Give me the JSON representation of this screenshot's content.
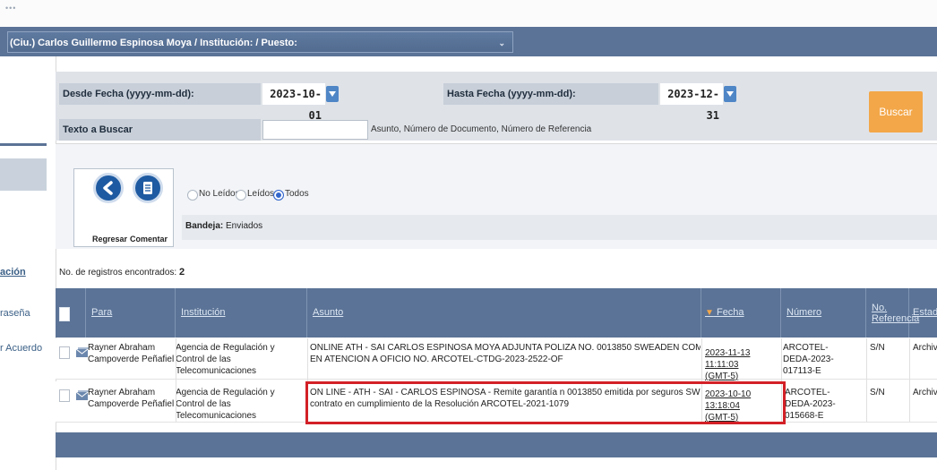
{
  "user_bar": {
    "title": "(Ciu.) Carlos Guillermo Espinosa Moya / Institución: / Puesto:"
  },
  "left_nav": {
    "items": [
      "ación",
      "raseña",
      "r Acuerdo"
    ]
  },
  "filters": {
    "desde_label": "Desde Fecha (yyyy-mm-dd):",
    "desde_value": "2023-10-01",
    "hasta_label": "Hasta Fecha (yyyy-mm-dd):",
    "hasta_value": "2023-12-31",
    "texto_label": "Texto a Buscar",
    "texto_value": "",
    "texto_hint": "Asunto, Número de Documento, Número de Referencia",
    "buscar_label": "Buscar"
  },
  "actions": {
    "regresar": "Regresar",
    "comentar": "Comentar",
    "radios": [
      {
        "label": "No Leídos",
        "selected": false
      },
      {
        "label": "Leídos",
        "selected": false
      },
      {
        "label": "Todos",
        "selected": true
      }
    ],
    "bandeja_label": "Bandeja:",
    "bandeja_value": "Enviados"
  },
  "results": {
    "count_label": "No. de registros encontrados:",
    "count_value": "2"
  },
  "table": {
    "headers": {
      "para": "Para",
      "institucion": "Institución",
      "asunto": "Asunto",
      "fecha": "Fecha Documento",
      "numero": "Número Documento",
      "referencia_1": "No.",
      "referencia_2": "Referencia",
      "estado": "Estado"
    },
    "rows": [
      {
        "para_1": "Rayner Abraham",
        "para_2": "Campoverde Peñafiel",
        "institucion_1": "Agencia de Regulación y Control de las",
        "institucion_2": "Telecomunicaciones",
        "asunto_1": "ONLINE ATH - SAI CARLOS ESPINOSA MOYA ADJUNTA POLIZA NO. 0013850 SWEADEN COMO GARANTIA DE FIEL CUMPLIMIENTO",
        "asunto_2": "EN ATENCION A OFICIO NO. ARCOTEL-CTDG-2023-2522-OF",
        "fecha_1": "2023-11-13 11:11:03",
        "fecha_2": "(GMT-5)",
        "numero_1": "ARCOTEL-",
        "numero_2": "DEDA-2023-017113-E",
        "referencia": "S/N",
        "estado": "Archivad"
      },
      {
        "para_1": "Rayner Abraham",
        "para_2": "Campoverde Peñafiel",
        "institucion_1": "Agencia de Regulación y Control de las",
        "institucion_2": "Telecomunicaciones",
        "asunto_1": "ON LINE - ATH - SAI - CARLOS ESPINOSA - Remite garantía n 0013850 emitida por seguros SWEADEN como fiel cumplimiento de",
        "asunto_2": "contrato en cumplimiento de la Resolución ARCOTEL-2021-1079",
        "fecha_1": "2023-10-10 13:18:04",
        "fecha_2": "(GMT-5)",
        "numero_1": "ARCOTEL-",
        "numero_2": "DEDA-2023-015668-E",
        "referencia": "S/N",
        "estado": "Archivad"
      }
    ]
  },
  "colors": {
    "header_blue": "#5b7396",
    "buscar_orange": "#f3a749",
    "highlight_red": "#d32027"
  }
}
